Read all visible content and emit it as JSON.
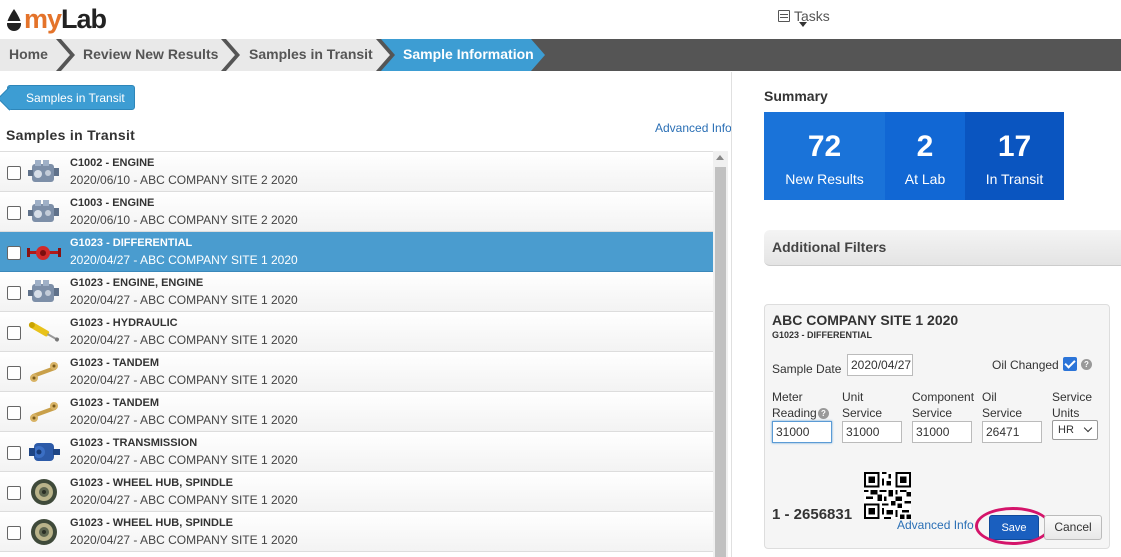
{
  "header": {
    "logo_prefix": "my",
    "logo_suffix": "Lab",
    "tasks_label": "Tasks"
  },
  "breadcrumb": [
    "Home",
    "Review New Results",
    "Samples in Transit",
    "Sample Information"
  ],
  "left": {
    "back_button": "Samples in Transit",
    "title": "Samples in Transit",
    "advanced_info": "Advanced Info",
    "rows": [
      {
        "title": "C1002 - ENGINE",
        "sub": "2020/06/10 - ABC COMPANY SITE 2 2020",
        "icon": "engine-icon"
      },
      {
        "title": "C1003 - ENGINE",
        "sub": "2020/06/10 - ABC COMPANY SITE 2 2020",
        "icon": "engine-icon"
      },
      {
        "title": "G1023 - DIFFERENTIAL",
        "sub": "2020/04/27 - ABC COMPANY SITE 1 2020",
        "icon": "differential-icon"
      },
      {
        "title": "G1023 - ENGINE, ENGINE",
        "sub": "2020/04/27 - ABC COMPANY SITE 1 2020",
        "icon": "engine-icon"
      },
      {
        "title": "G1023 - HYDRAULIC",
        "sub": "2020/04/27 - ABC COMPANY SITE 1 2020",
        "icon": "hydraulic-cylinder-icon"
      },
      {
        "title": "G1023 - TANDEM",
        "sub": "2020/04/27 - ABC COMPANY SITE 1 2020",
        "icon": "tandem-icon"
      },
      {
        "title": "G1023 - TANDEM",
        "sub": "2020/04/27 - ABC COMPANY SITE 1 2020",
        "icon": "tandem-icon"
      },
      {
        "title": "G1023 - TRANSMISSION",
        "sub": "2020/04/27 - ABC COMPANY SITE 1 2020",
        "icon": "transmission-icon"
      },
      {
        "title": "G1023 - WHEEL HUB, SPINDLE",
        "sub": "2020/04/27 - ABC COMPANY SITE 1 2020",
        "icon": "wheel-hub-icon"
      },
      {
        "title": "G1023 - WHEEL HUB, SPINDLE",
        "sub": "2020/04/27 - ABC COMPANY SITE 1 2020",
        "icon": "wheel-hub-icon"
      }
    ]
  },
  "summary": {
    "title": "Summary",
    "boxes": [
      {
        "value": "72",
        "label": "New Results",
        "color": "#1a73d9"
      },
      {
        "value": "2",
        "label": "At Lab",
        "color": "#1167d4"
      },
      {
        "value": "17",
        "label": "In Transit",
        "color": "#0a55c0"
      }
    ]
  },
  "filters": {
    "title": "Additional Filters"
  },
  "detail": {
    "site": "ABC COMPANY SITE 1 2020",
    "component": "G1023 - DIFFERENTIAL",
    "sample_date_label": "Sample Date",
    "sample_date": "2020/04/27",
    "oil_changed_label": "Oil Changed",
    "meter_reading_label_1": "Meter",
    "meter_reading_label_2": "Reading",
    "meter_reading": "31000",
    "unit_service_label_1": "Unit",
    "unit_service_label_2": "Service",
    "unit_service": "31000",
    "component_service_label_1": "Component",
    "component_service_label_2": "Service",
    "component_service": "31000",
    "oil_service_label_1": "Oil",
    "oil_service_label_2": "Service",
    "oil_service": "26471",
    "service_units_label_1": "Service",
    "service_units_label_2": "Units",
    "service_units": "HR",
    "sample_number": "1 - 2656831",
    "advanced_info": "Advanced Info",
    "save": "Save",
    "cancel": "Cancel"
  },
  "colors": {
    "accent": "#4a9ccf",
    "breadcrumb_active": "#3d9dd3",
    "brand_orange": "#e4732a",
    "highlight_ring": "#d4146a"
  }
}
